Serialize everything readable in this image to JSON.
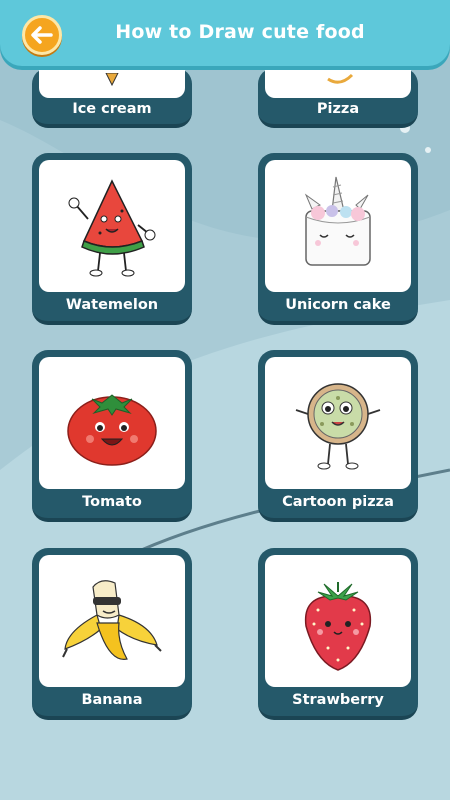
{
  "header": {
    "title": "How to Draw cute food",
    "back_icon": "arrow-left-icon",
    "colors": {
      "bar": "#5ec8da",
      "back_button": "#f5a51f"
    }
  },
  "items": [
    {
      "label": "Ice cream",
      "icon": "ice-cream-icon"
    },
    {
      "label": "Pizza",
      "icon": "pizza-slice-icon"
    },
    {
      "label": "Watemelon",
      "icon": "watermelon-slice-icon"
    },
    {
      "label": "Unicorn cake",
      "icon": "unicorn-cake-icon"
    },
    {
      "label": "Tomato",
      "icon": "tomato-icon"
    },
    {
      "label": "Cartoon pizza",
      "icon": "cartoon-pizza-icon"
    },
    {
      "label": "Banana",
      "icon": "banana-icon"
    },
    {
      "label": "Strawberry",
      "icon": "strawberry-icon"
    }
  ],
  "colors": {
    "card": "#25596a",
    "background": "#a9cbd6"
  }
}
